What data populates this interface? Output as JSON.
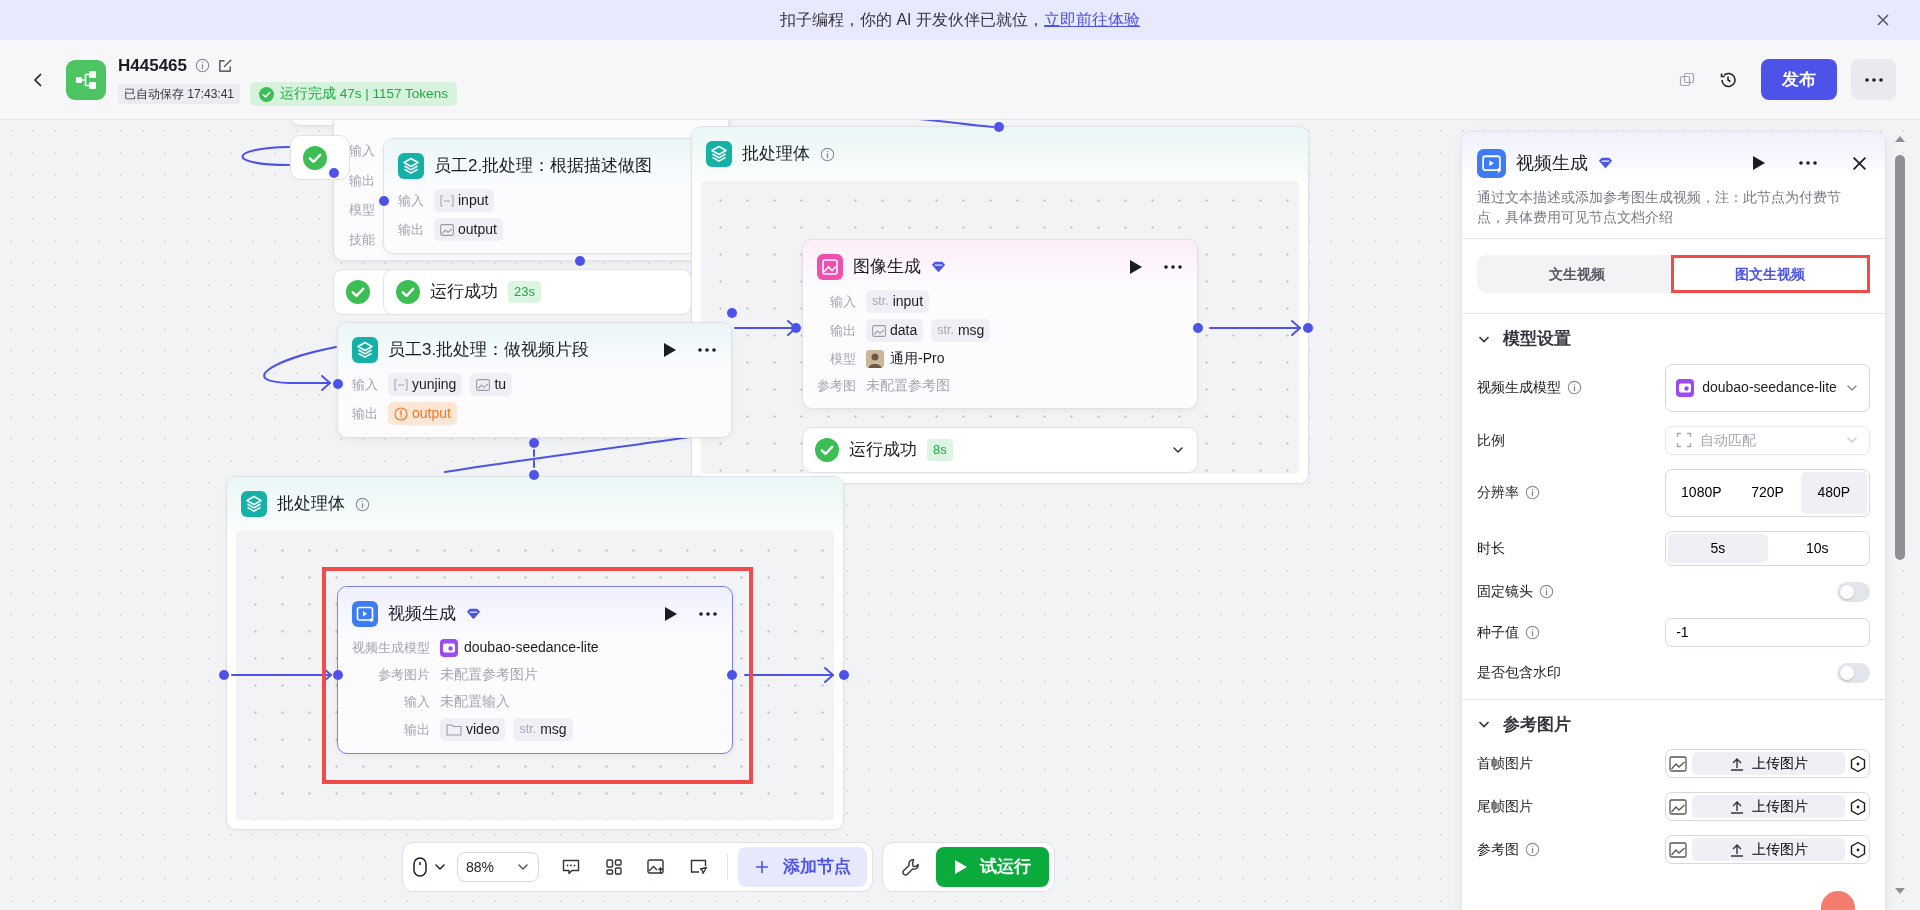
{
  "banner": {
    "text": "扣子编程，你的 AI 开发伙伴已就位，",
    "link": "立即前往体验"
  },
  "header": {
    "title": "H445465",
    "autosave": "已自动保存 17:43:41",
    "run_status": "运行完成 47s | 1157 Tokens",
    "publish_button": "发布"
  },
  "canvas": {
    "hidden_node_labels": [
      "输入",
      "输出",
      "模型",
      "技能"
    ],
    "groups": [
      {
        "title": "批处理体"
      },
      {
        "title": "批处理体"
      }
    ],
    "nodes": [
      {
        "title": "员工2.批处理：根据描述做图",
        "selected": false,
        "rows": [
          {
            "label": "输入",
            "kind": "tags",
            "tags": [
              {
                "kind": "strbox",
                "text": "input"
              }
            ]
          },
          {
            "label": "输出",
            "kind": "tags",
            "tags": [
              {
                "kind": "img",
                "text": "output"
              }
            ]
          }
        ]
      },
      {
        "title": "员工3.批处理：做视频片段",
        "actions": true,
        "selected": false,
        "rows": [
          {
            "label": "输入",
            "kind": "tags",
            "tags": [
              {
                "kind": "strbox",
                "text": "yunjing"
              },
              {
                "kind": "img",
                "text": "tu"
              }
            ]
          },
          {
            "label": "输出",
            "kind": "tags",
            "tags": [
              {
                "kind": "warn",
                "text": "output"
              }
            ]
          }
        ]
      },
      {
        "title": "图像生成",
        "premium": true,
        "actions": true,
        "selected": false,
        "rows": [
          {
            "label": "输入",
            "kind": "tags",
            "tags": [
              {
                "kind": "str",
                "prefix": "str.",
                "text": "input"
              }
            ]
          },
          {
            "label": "输出",
            "kind": "tags",
            "tags": [
              {
                "kind": "img",
                "text": "data"
              },
              {
                "kind": "str",
                "prefix": "str.",
                "text": "msg"
              }
            ]
          },
          {
            "label": "模型",
            "kind": "avatar",
            "value": "通用-Pro"
          },
          {
            "label": "参考图",
            "kind": "empty",
            "value": "未配置参考图"
          }
        ]
      },
      {
        "title": "视频生成",
        "premium": true,
        "actions": true,
        "selected": true,
        "highlighted": true,
        "rows": [
          {
            "label": "视频生成模型",
            "kind": "app",
            "value": "doubao-seedance-lite"
          },
          {
            "label": "参考图片",
            "kind": "empty",
            "value": "未配置参考图片"
          },
          {
            "label": "输入",
            "kind": "empty",
            "value": "未配置输入"
          },
          {
            "label": "输出",
            "kind": "tags",
            "tags": [
              {
                "kind": "folder",
                "text": "video"
              },
              {
                "kind": "str",
                "prefix": "str.",
                "text": "msg"
              }
            ]
          }
        ]
      }
    ],
    "status_bars": [
      {
        "text": "运行成功",
        "duration": "23s"
      },
      {
        "text": "运行成功",
        "duration": "8s",
        "expandable": true
      }
    ]
  },
  "toolbar": {
    "zoom": "88%",
    "add_node": "添加节点",
    "test_run": "试运行"
  },
  "panel": {
    "title": "视频生成",
    "premium": true,
    "description": "通过文本描述或添加参考图生成视频，注：此节点为付费节点，具体费用可见节点文档介绍",
    "tabs": [
      {
        "label": "文生视频",
        "selected": false
      },
      {
        "label": "图文生视频",
        "selected": true,
        "highlighted": true
      }
    ],
    "sections": [
      {
        "title": "模型设置",
        "expanded": true,
        "fields": [
          {
            "kind": "model",
            "label": "视频生成模型",
            "info": true,
            "value": "doubao-seedance-lite",
            "disabled": false
          },
          {
            "kind": "select",
            "label": "比例",
            "value": "自动匹配",
            "disabled": true
          },
          {
            "kind": "segmented",
            "label": "分辨率",
            "info": true,
            "options": [
              {
                "label": "1080P",
                "selected": false
              },
              {
                "label": "720P",
                "selected": false
              },
              {
                "label": "480P",
                "selected": true
              }
            ]
          },
          {
            "kind": "segmented",
            "label": "时长",
            "options": [
              {
                "label": "5s",
                "selected": true
              },
              {
                "label": "10s",
                "selected": false
              }
            ]
          },
          {
            "kind": "toggle",
            "label": "固定镜头",
            "info": true,
            "on": false
          },
          {
            "kind": "input",
            "label": "种子值",
            "info": true,
            "value": "-1"
          },
          {
            "kind": "toggle",
            "label": "是否包含水印",
            "on": false
          }
        ]
      },
      {
        "title": "参考图片",
        "expanded": true,
        "fields": [
          {
            "kind": "upload",
            "label": "首帧图片",
            "button": "上传图片"
          },
          {
            "kind": "upload",
            "label": "尾帧图片",
            "button": "上传图片"
          },
          {
            "kind": "upload",
            "label": "参考图",
            "info": true,
            "button": "上传图片"
          }
        ]
      }
    ]
  }
}
